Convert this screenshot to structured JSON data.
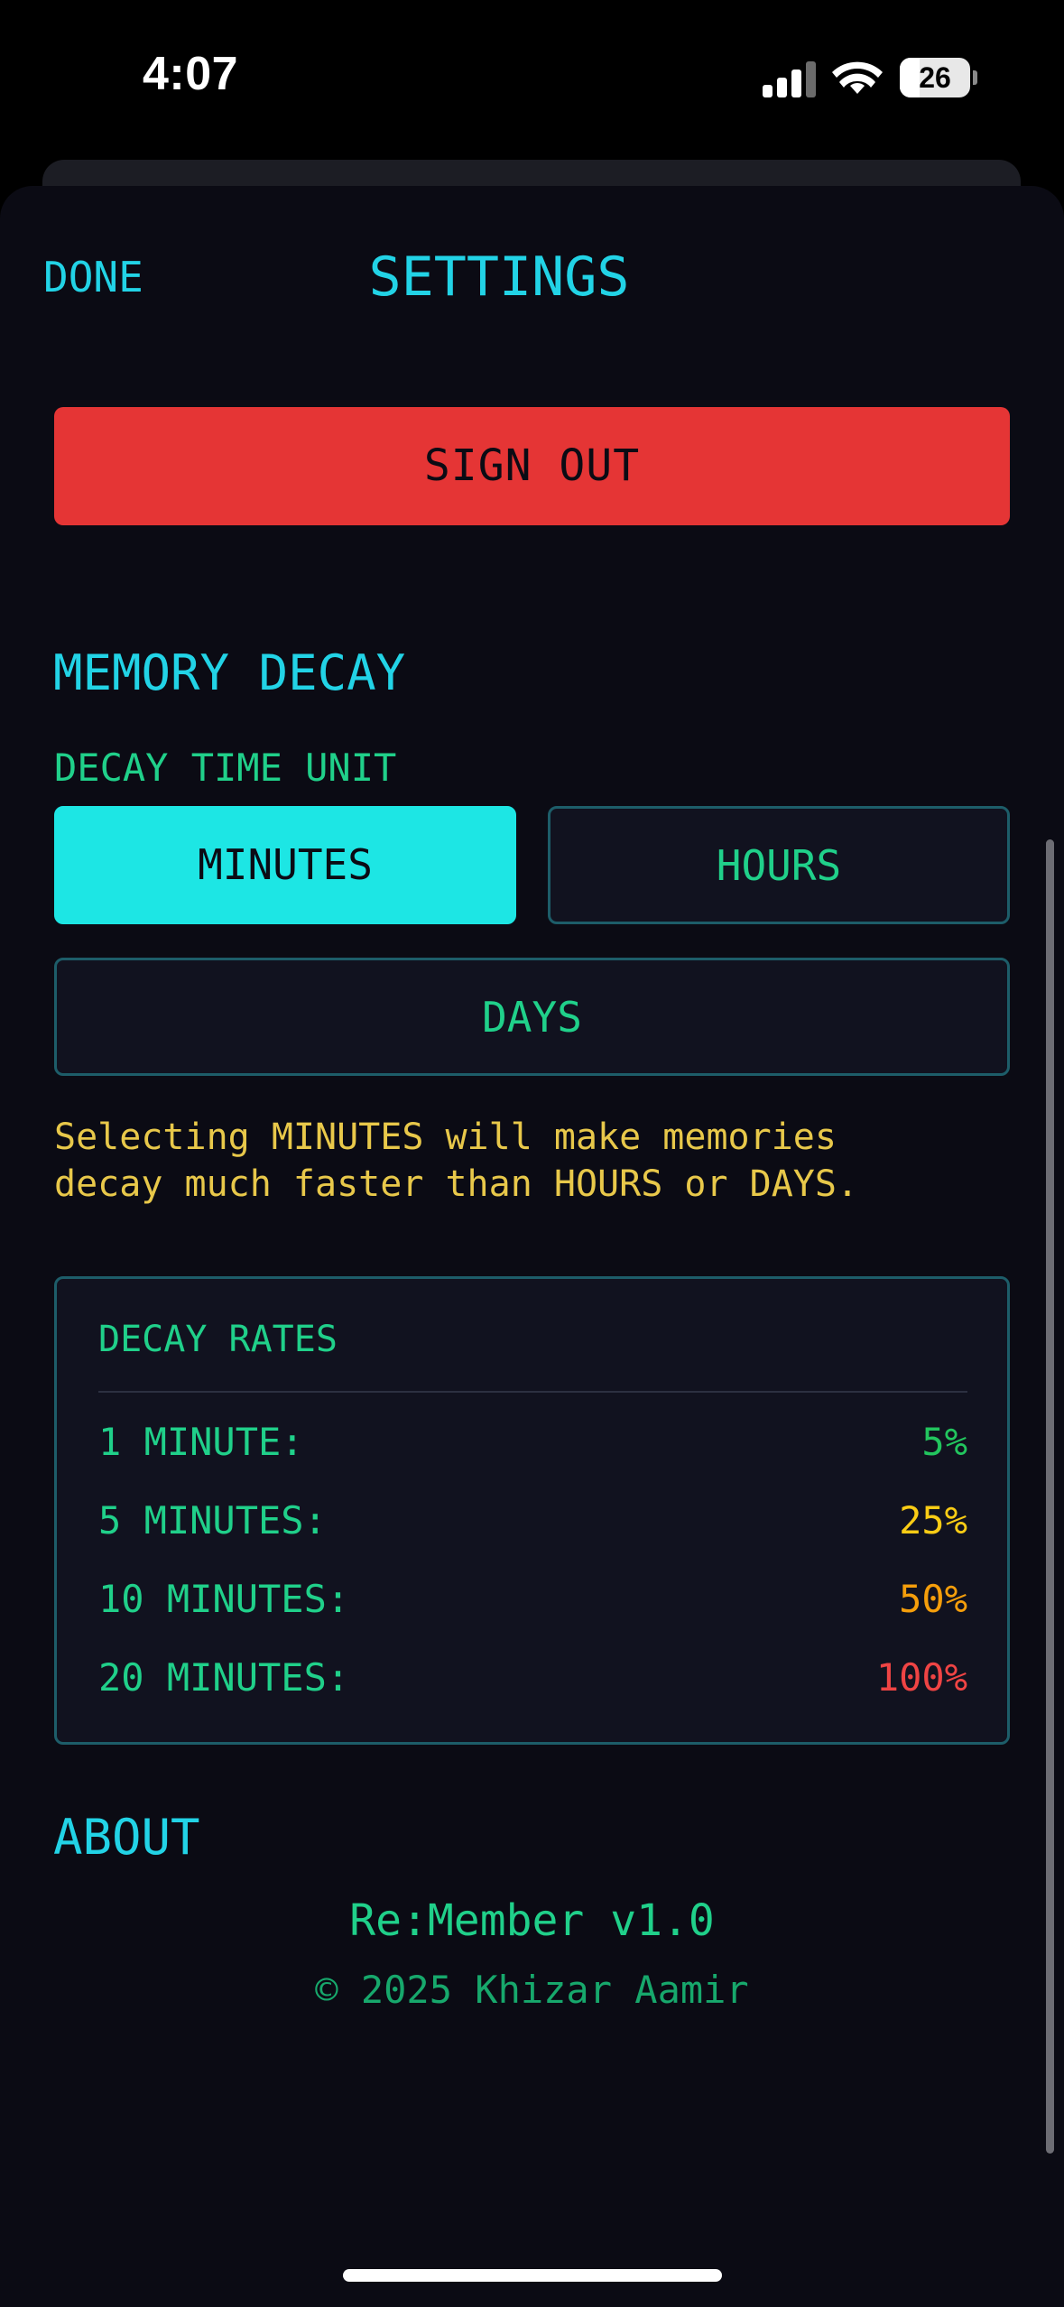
{
  "status_bar": {
    "time": "4:07",
    "battery_level": "26",
    "signal_icon": "cellular-signal-icon",
    "wifi_icon": "wifi-icon",
    "battery_icon": "battery-icon"
  },
  "header": {
    "done_label": "DONE",
    "title": "SETTINGS"
  },
  "account": {
    "sign_out_label": "SIGN OUT"
  },
  "memory_decay": {
    "heading": "MEMORY DECAY",
    "time_unit_label": "DECAY TIME UNIT",
    "options": [
      {
        "label": "MINUTES",
        "selected": true
      },
      {
        "label": "HOURS",
        "selected": false
      },
      {
        "label": "DAYS",
        "selected": false
      }
    ],
    "hint": "Selecting MINUTES will make memories\ndecay much faster than HOURS or DAYS."
  },
  "decay_rates": {
    "title": "DECAY RATES",
    "rows": [
      {
        "label": "1 MINUTE:",
        "value": "5%",
        "color": "#22c55e"
      },
      {
        "label": "5 MINUTES:",
        "value": "25%",
        "color": "#facc15"
      },
      {
        "label": "10 MINUTES:",
        "value": "50%",
        "color": "#f59e0b"
      },
      {
        "label": "20 MINUTES:",
        "value": "100%",
        "color": "#ef4444"
      }
    ]
  },
  "about": {
    "heading": "ABOUT",
    "app_version": "Re:Member v1.0",
    "copyright": "© 2025 Khizar Aamir"
  },
  "colors": {
    "accent": "#22d3e6",
    "green": "#20d08a",
    "danger": "#e53535",
    "warning_text": "#e8c84a",
    "background": "#0b0b14"
  }
}
